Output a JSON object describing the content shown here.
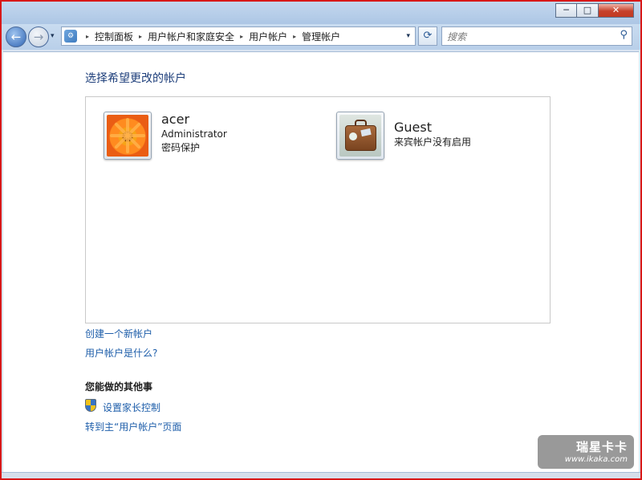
{
  "window": {
    "minimize_glyph": "─",
    "maximize_glyph": "□",
    "close_glyph": "✕"
  },
  "navigation": {
    "back_glyph": "←",
    "forward_glyph": "→",
    "dropdown_glyph": "▾"
  },
  "address": {
    "breadcrumbs": [
      "控制面板",
      "用户帐户和家庭安全",
      "用户帐户",
      "管理帐户"
    ],
    "separator": "▸",
    "dropdown_glyph": "▾",
    "icon": "control-panel-icon"
  },
  "refresh_glyph": "⟳",
  "search": {
    "placeholder": "搜索",
    "icon_glyph": "⚲"
  },
  "main": {
    "heading": "选择希望更改的帐户",
    "accounts": [
      {
        "name": "acer",
        "line1": "Administrator",
        "line2": "密码保护",
        "picture": "orange-flower"
      },
      {
        "name": "Guest",
        "line1": "来宾帐户没有启用",
        "picture": "suitcase"
      }
    ],
    "links": {
      "create": "创建一个新帐户",
      "what": "用户帐户是什么?"
    },
    "other_heading": "您能做的其他事",
    "other_links": {
      "parental": "设置家长控制",
      "main_page": "转到主“用户帐户”页面"
    }
  },
  "watermark": {
    "brand": "瑞星卡卡",
    "url": "www.ikaka.com"
  },
  "colors": {
    "link": "#1e5eaa",
    "heading": "#1e3f7b",
    "frame": "#d81818"
  }
}
